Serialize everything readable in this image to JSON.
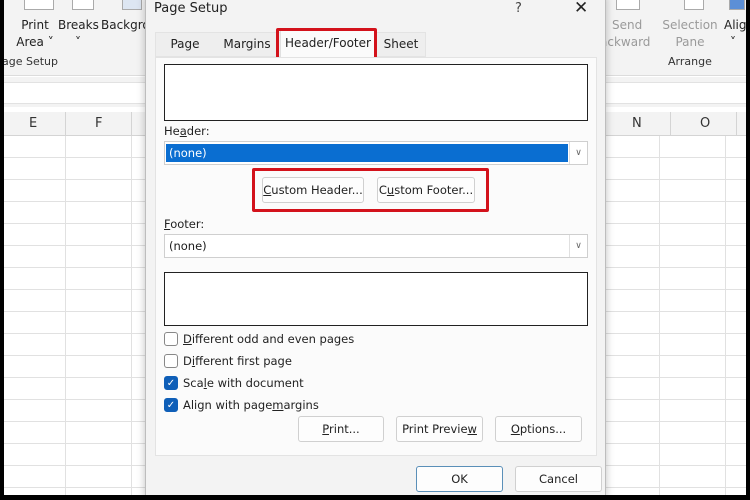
{
  "excel": {
    "ribbon": {
      "print_area": [
        "Print",
        "Area ˅"
      ],
      "breaks": [
        "Breaks",
        "˅"
      ],
      "background": "Backgro",
      "page_setup_group": "age Setup",
      "send_backward": [
        "Send",
        "ackward ˅"
      ],
      "selection_pane": [
        "Selection",
        "Pane"
      ],
      "align": [
        "Alig",
        "˅"
      ],
      "arrange_group": "Arrange"
    },
    "columns": [
      "E",
      "F",
      "N",
      "O"
    ]
  },
  "dialog": {
    "title": "Page Setup",
    "help": "?",
    "close": "✕",
    "tabs": [
      {
        "label": "Page",
        "active": false
      },
      {
        "label": "Margins",
        "active": false
      },
      {
        "label": "Header/Footer",
        "active": true
      },
      {
        "label": "Sheet",
        "active": false
      }
    ],
    "header_label": {
      "pre": "He",
      "u": "a",
      "post": "der:"
    },
    "header_value": "(none)",
    "custom_header": {
      "pre": "",
      "u": "C",
      "post": "ustom Header..."
    },
    "custom_footer": {
      "pre": "C",
      "u": "u",
      "post": "stom Footer..."
    },
    "footer_label": {
      "pre": "",
      "u": "F",
      "post": "ooter:"
    },
    "footer_value": "(none)",
    "checkboxes": [
      {
        "pre": "",
        "u": "D",
        "post": "ifferent odd and even pages",
        "checked": false
      },
      {
        "pre": "D",
        "u": "i",
        "post": "fferent first page",
        "checked": false
      },
      {
        "pre": "Sca",
        "u": "l",
        "post": "e with document",
        "checked": true
      },
      {
        "pre": "Align with page ",
        "u": "m",
        "post": "argins",
        "checked": true
      }
    ],
    "print_btn": {
      "pre": "",
      "u": "P",
      "post": "rint..."
    },
    "preview_btn": {
      "pre": "Print Previe",
      "u": "w",
      "post": ""
    },
    "options_btn": {
      "pre": "",
      "u": "O",
      "post": "ptions..."
    },
    "ok": "OK",
    "cancel": "Cancel",
    "highlight_color": "#d3121b",
    "selection_color": "#0a6ed1"
  }
}
